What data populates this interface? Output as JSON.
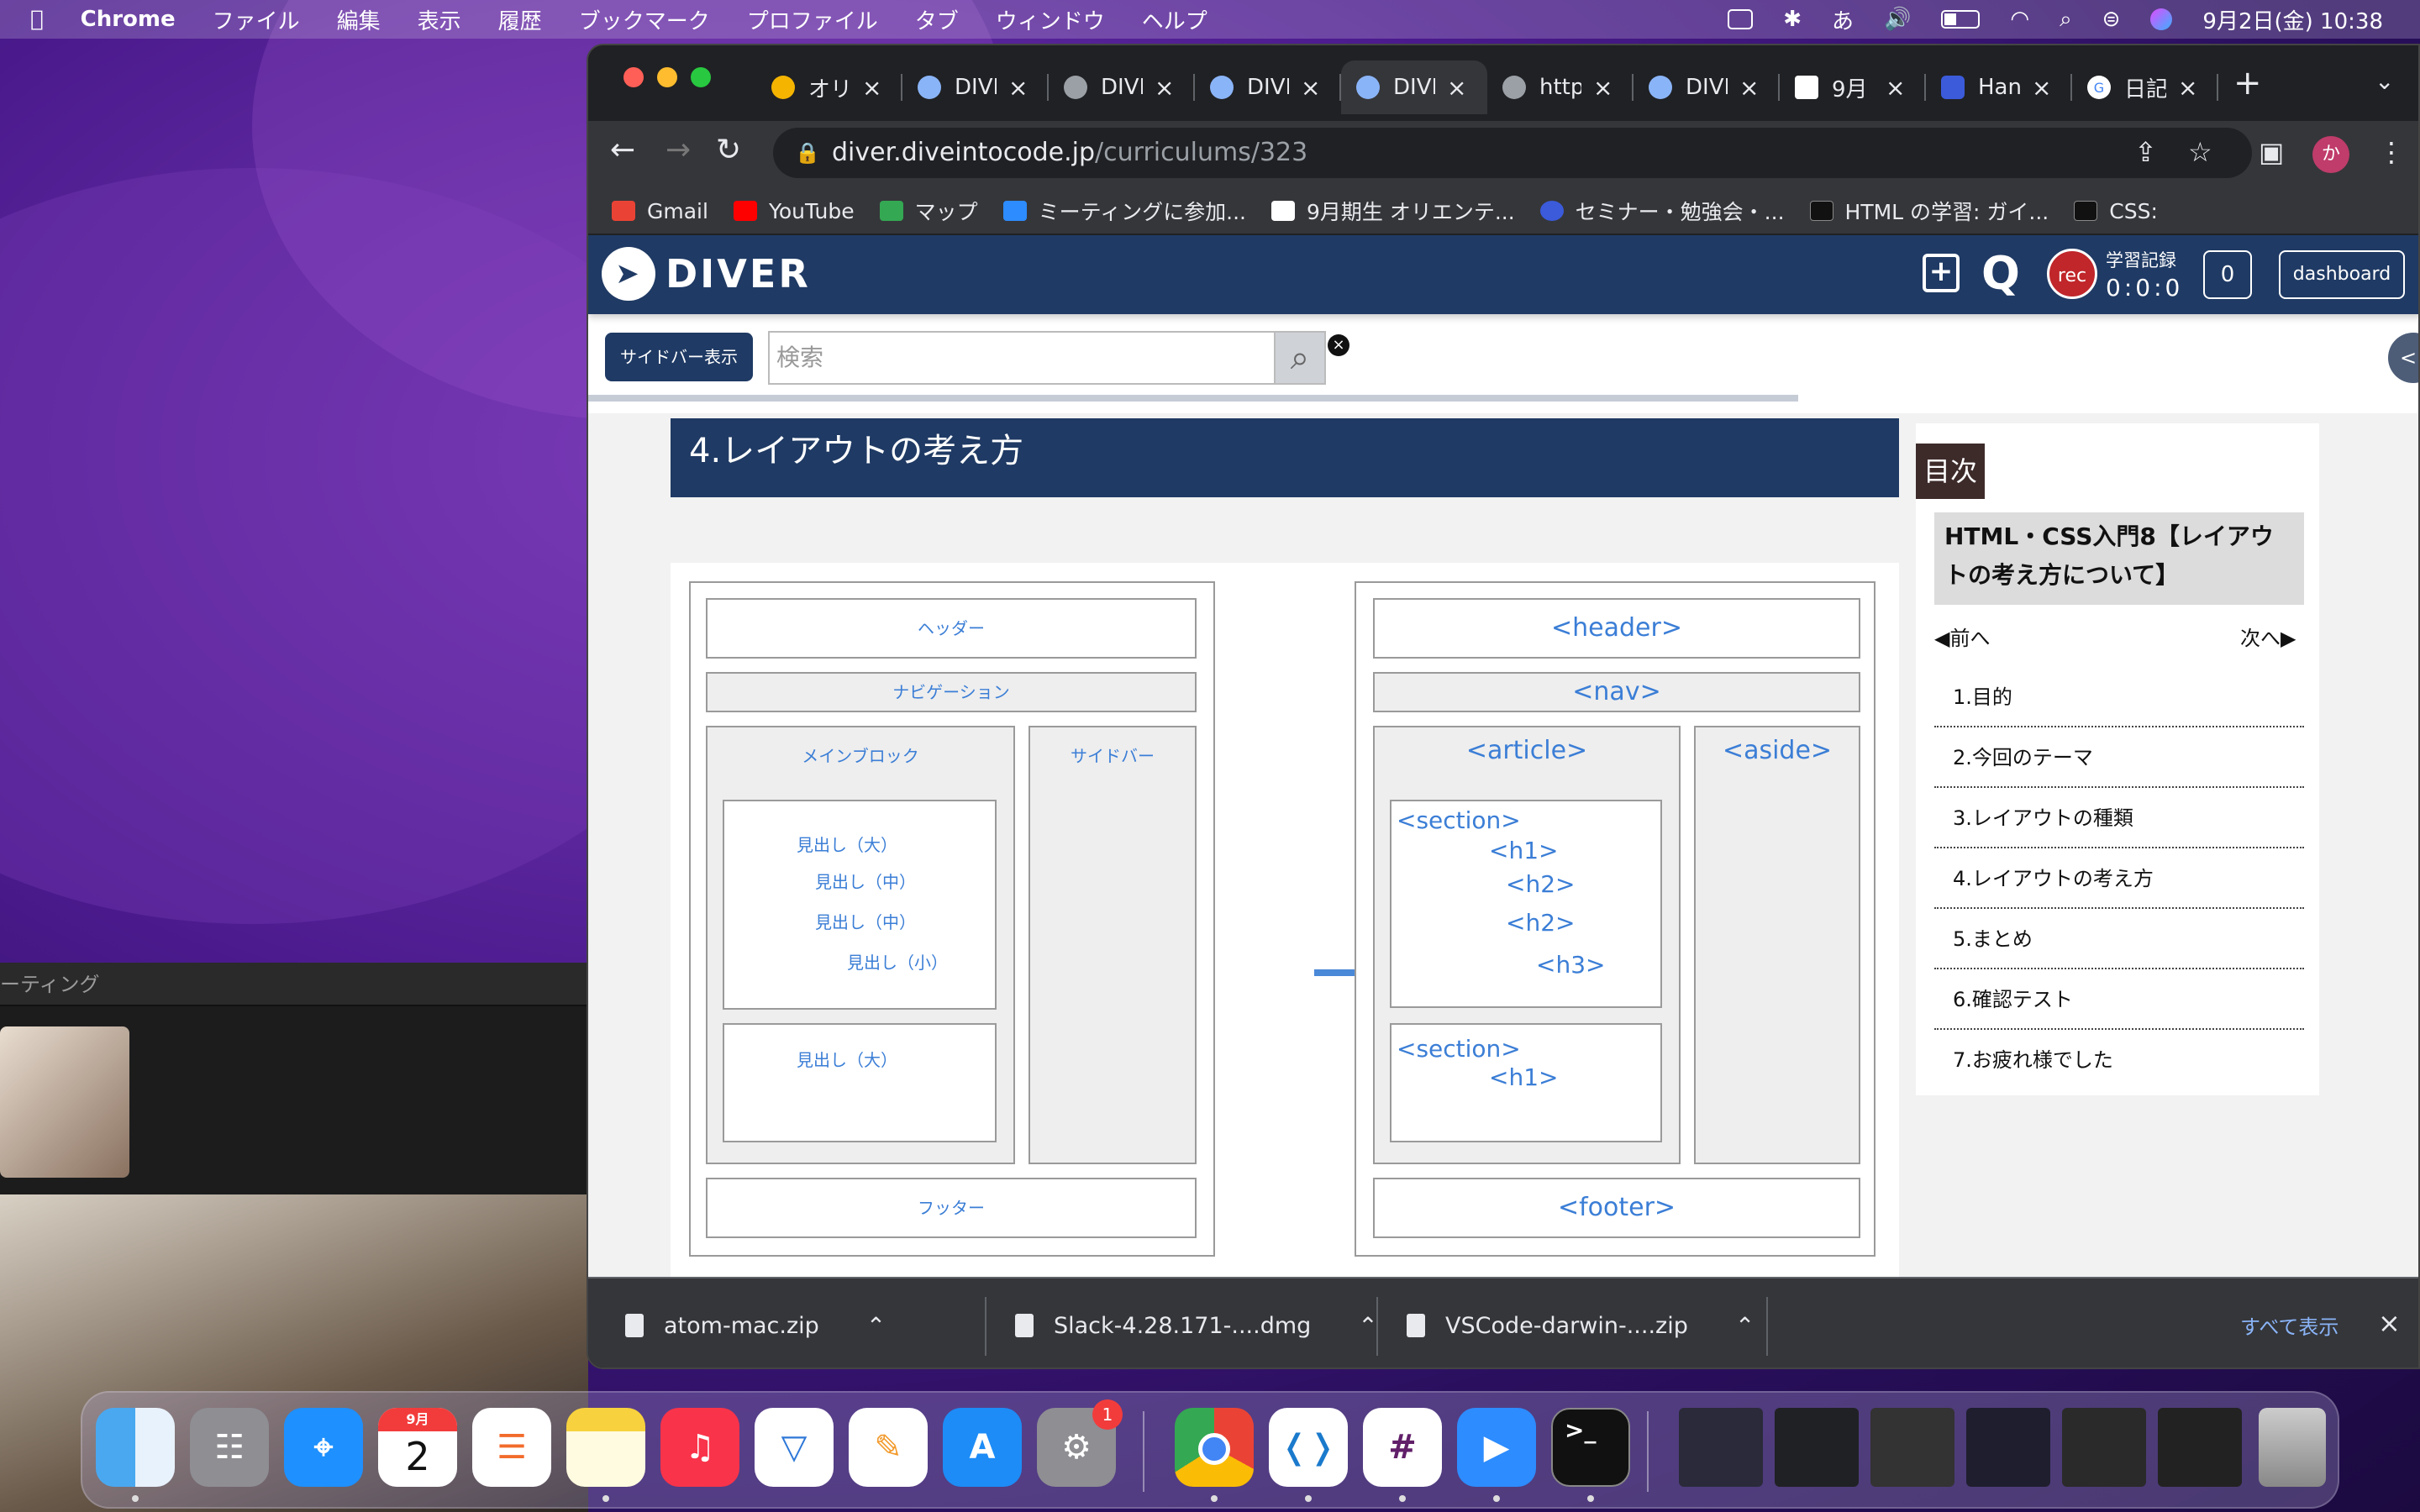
{
  "menubar": {
    "app": "Chrome",
    "items": [
      "ファイル",
      "編集",
      "表示",
      "履歴",
      "ブックマーク",
      "プロファイル",
      "タブ",
      "ウィンドウ",
      "ヘルプ"
    ],
    "ime": "あ",
    "datetime": "9月2日(金)  10:38"
  },
  "zoom": {
    "title": "ーティング"
  },
  "tabs": [
    "オリ",
    "DIVE",
    "DIVE",
    "DIVE",
    "DIVE",
    "http",
    "DIVE",
    "9月",
    "Han",
    "日記"
  ],
  "omnibox": {
    "host": "diver.diveintocode.jp",
    "path": "/curriculums/323"
  },
  "profile_initial": "か",
  "bookmarks": [
    "Gmail",
    "YouTube",
    "マップ",
    "ミーティングに参加...",
    "9月期生 オリエンテ...",
    "セミナー・勉強会・...",
    "HTML の学習: ガイ...",
    "CSS:"
  ],
  "diver": {
    "logo": "DIVER",
    "rec": "rec",
    "rec_label": "学習記録",
    "rec_time": "0:0:0",
    "counter": "0",
    "dashboard": "dashboard"
  },
  "search": {
    "sidebar_button": "サイドバー表示",
    "placeholder": "検索"
  },
  "section_title": "4.レイアウトの考え方",
  "figure": {
    "left": {
      "header": "ヘッダー",
      "nav": "ナビゲーション",
      "main": "メインブロック",
      "sidebar": "サイドバー",
      "h_big": "見出し（大）",
      "h_mid1": "見出し（中）",
      "h_mid2": "見出し（中）",
      "h_small": "見出し（小）",
      "h_big2": "見出し（大）",
      "footer": "フッター"
    },
    "right": {
      "header": "<header>",
      "nav": "<nav>",
      "article": "<article>",
      "aside": "<aside>",
      "section1": "<section>",
      "h1": "<h1>",
      "h2a": "<h2>",
      "h2b": "<h2>",
      "h3": "<h3>",
      "section2": "<section>",
      "h1b": "<h1>",
      "footer": "<footer>"
    }
  },
  "toc": {
    "head": "目次",
    "title": "HTML・CSS入門8【レイアウトの考え方について】",
    "prev": "◀前へ",
    "next": "次へ▶",
    "items": [
      "1.目的",
      "2.今回のテーマ",
      "3.レイアウトの種類",
      "4.レイアウトの考え方",
      "5.まとめ",
      "6.確認テスト",
      "7.お疲れ様でした"
    ]
  },
  "downloads": {
    "files": [
      "atom-mac.zip",
      "Slack-4.28.171-....dmg",
      "VSCode-darwin-....zip"
    ],
    "show_all": "すべて表示"
  },
  "dock": {
    "calendar_month": "9月",
    "calendar_day": "2",
    "settings_badge": "1"
  }
}
